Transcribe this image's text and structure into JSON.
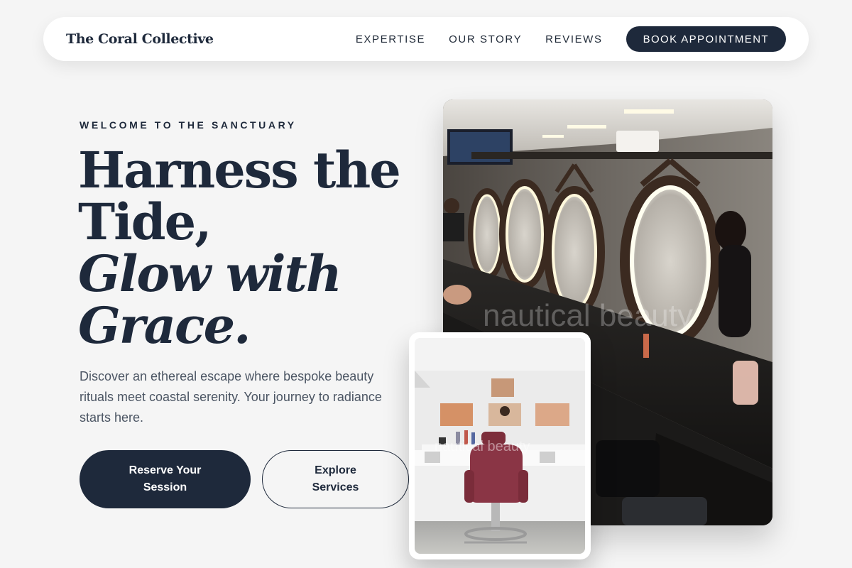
{
  "nav": {
    "brand": "The Coral Collective",
    "links": [
      "EXPERTISE",
      "OUR STORY",
      "REVIEWS"
    ],
    "cta": "BOOK APPOINTMENT"
  },
  "hero": {
    "eyebrow": "WELCOME TO THE SANCTUARY",
    "headline_line1": "Harness the",
    "headline_line2": "Tide,",
    "headline_line3": "Glow with",
    "headline_line4": "Grace.",
    "lede": "Discover an ethereal escape where bespoke beauty rituals meet coastal serenity. Your journey to radiance starts here.",
    "primary_button": "Reserve Your Session",
    "secondary_button": "Explore Services"
  },
  "images": {
    "main_watermark": "nautical beauty",
    "inset_watermark": "nautical beauty"
  },
  "colors": {
    "background": "#f5f5f5",
    "navy": "#1e293b",
    "body_text": "#4b5563"
  }
}
